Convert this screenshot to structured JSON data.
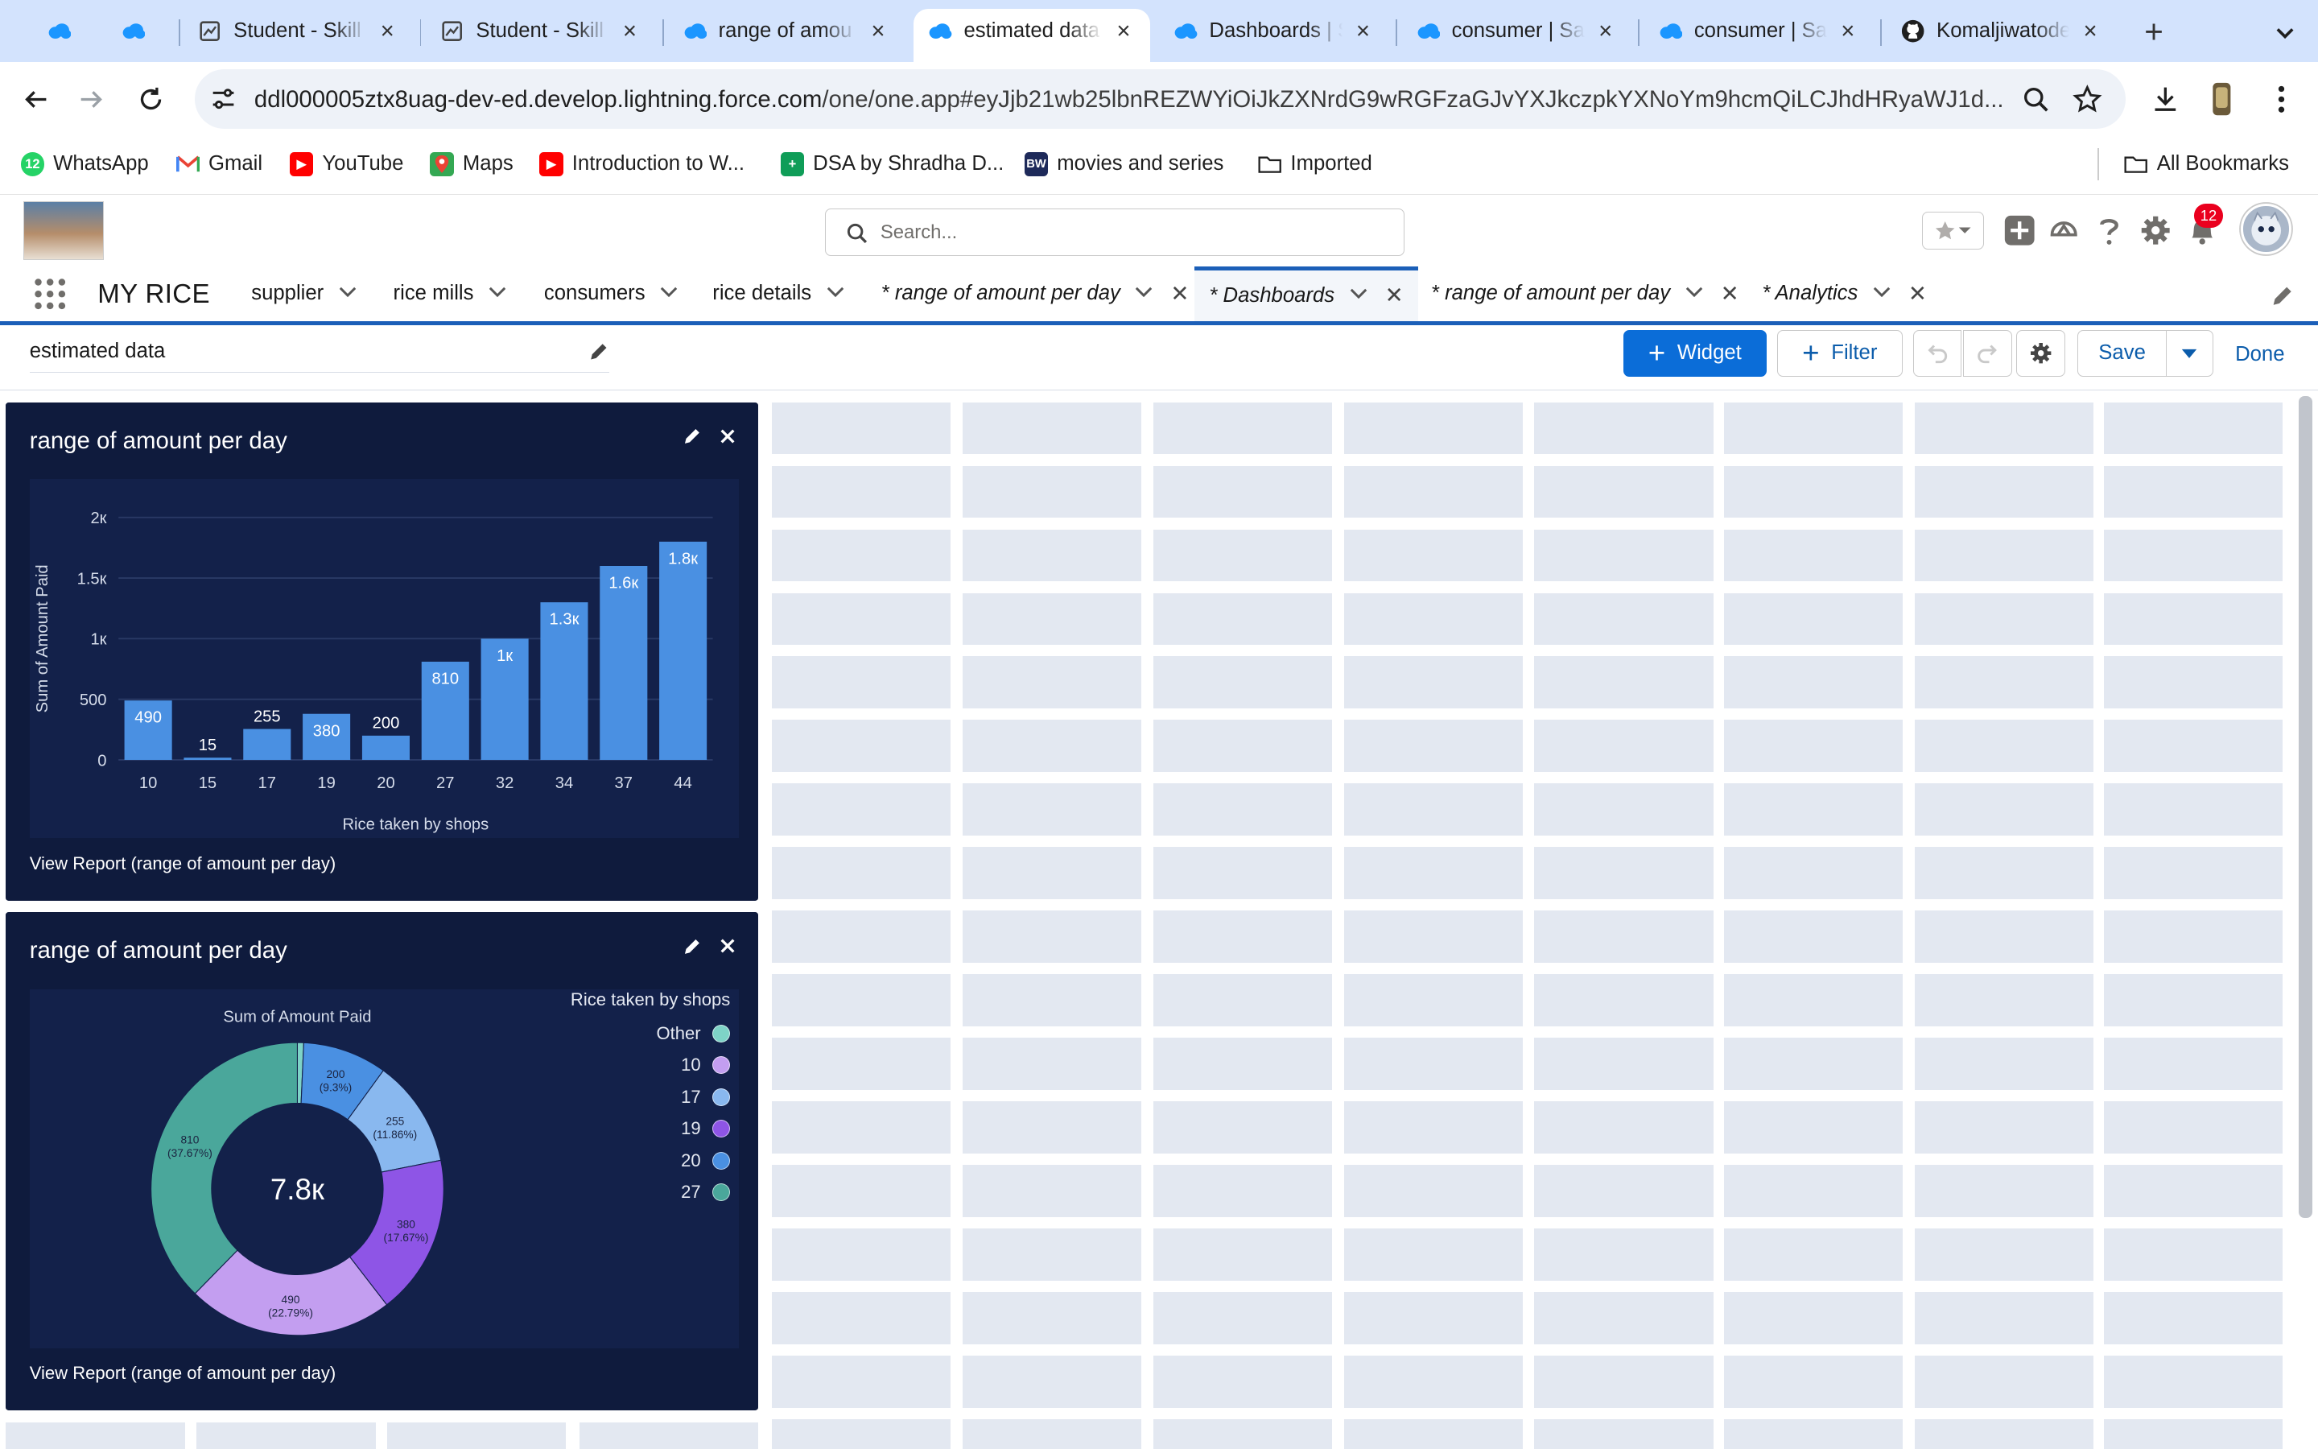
{
  "browser": {
    "tabs": [
      {
        "title": "",
        "icon": "salesforce-cloud-icon",
        "pinned": true
      },
      {
        "title": "",
        "icon": "salesforce-cloud-icon",
        "pinned": true
      },
      {
        "title": "Student - Skill",
        "icon": "document-icon"
      },
      {
        "title": "Student - Skill",
        "icon": "document-icon"
      },
      {
        "title": "range of amou",
        "icon": "salesforce-cloud-icon"
      },
      {
        "title": "estimated data",
        "icon": "salesforce-cloud-icon",
        "active": true
      },
      {
        "title": "Dashboards | Sa",
        "icon": "salesforce-cloud-icon"
      },
      {
        "title": "consumer | Sa",
        "icon": "salesforce-cloud-icon"
      },
      {
        "title": "consumer | Sa",
        "icon": "salesforce-cloud-icon"
      },
      {
        "title": "Komaljiwatode",
        "icon": "github-icon"
      }
    ],
    "url_host": "ddl000005ztx8uag-dev-ed.develop.lightning.force.com",
    "url_path": "/one/one.app#eyJjb21wb25lbnREZWYiOiJkZXNrdG9wRGFzaGJvYXJkczpkYXNoYm9hcmQiLCJhdHRyaWJ1d...",
    "bookmarks": [
      {
        "label": "WhatsApp",
        "icon": "whatsapp-icon",
        "color": "#25d366"
      },
      {
        "label": "Gmail",
        "icon": "gmail-icon",
        "color": "#ea4335"
      },
      {
        "label": "YouTube",
        "icon": "youtube-icon",
        "color": "#ff0000"
      },
      {
        "label": "Maps",
        "icon": "maps-icon",
        "color": "#34a853"
      },
      {
        "label": "Introduction to W...",
        "icon": "youtube-icon",
        "color": "#ff0000"
      },
      {
        "label": "DSA by Shradha D...",
        "icon": "sheets-icon",
        "color": "#0f9d58"
      },
      {
        "label": "movies and series",
        "icon": "bw-icon",
        "color": "#1e2a5a"
      },
      {
        "label": "Imported",
        "icon": "folder-icon",
        "color": "#5f6368"
      }
    ],
    "all_bookmarks": "All Bookmarks"
  },
  "sf": {
    "search_placeholder": "Search...",
    "notification_count": "12",
    "app_name": "MY RICE",
    "nav": [
      {
        "label": "supplier"
      },
      {
        "label": "rice mills"
      },
      {
        "label": "consumers"
      },
      {
        "label": "rice details"
      },
      {
        "label": "* range of amount per day",
        "closable": true
      },
      {
        "label": "* Dashboards",
        "closable": true,
        "current": true
      },
      {
        "label": "* range of amount per day",
        "closable": true
      },
      {
        "label": "* Analytics",
        "closable": true
      }
    ]
  },
  "builder": {
    "dashboard_name": "estimated data",
    "widget_label": "Widget",
    "filter_label": "Filter",
    "save_label": "Save",
    "done_label": "Done"
  },
  "widgets": [
    {
      "title": "range of amount per day",
      "link": "View Report (range of amount per day)"
    },
    {
      "title": "range of amount per day",
      "link": "View Report (range of amount per day)"
    }
  ],
  "chart_data": [
    {
      "type": "bar",
      "categories": [
        "10",
        "15",
        "17",
        "19",
        "20",
        "27",
        "32",
        "34",
        "37",
        "44"
      ],
      "values": [
        490,
        15,
        255,
        380,
        200,
        810,
        1000,
        1300,
        1600,
        1800
      ],
      "data_labels": [
        "490",
        "15",
        "255",
        "380",
        "200",
        "810",
        "1к",
        "1.3к",
        "1.6к",
        "1.8к"
      ],
      "xlabel": "Rice taken by shops",
      "ylabel": "Sum of Amount Paid",
      "yticks": [
        "0",
        "500",
        "1к",
        "1.5к",
        "2к"
      ],
      "ytick_values": [
        0,
        500,
        1000,
        1500,
        2000
      ],
      "ylim": [
        0,
        2000
      ],
      "bar_color": "#4a90e2",
      "grid": true
    },
    {
      "type": "pie",
      "title": "Sum of Amount Paid",
      "center_label": "7.8к",
      "legend_title": "Rice taken by shops",
      "legend_position": "right",
      "slices": [
        {
          "name": "Other",
          "value": 15,
          "label": "",
          "color": "#7ed3c7"
        },
        {
          "name": "20",
          "value": 200,
          "label": "200",
          "pct": "(9.3%)",
          "color": "#4a90e2"
        },
        {
          "name": "17",
          "value": 255,
          "label": "255",
          "pct": "(11.86%)",
          "color": "#89b8ef"
        },
        {
          "name": "19",
          "value": 380,
          "label": "380",
          "pct": "(17.67%)",
          "color": "#8e55e6"
        },
        {
          "name": "10",
          "value": 490,
          "label": "490",
          "pct": "(22.79%)",
          "color": "#c39ef0"
        },
        {
          "name": "27",
          "value": 810,
          "label": "810",
          "pct": "(37.67%)",
          "color": "#4aa79b"
        }
      ],
      "legend": [
        {
          "name": "Other",
          "color": "#7ed3c7"
        },
        {
          "name": "10",
          "color": "#c39ef0"
        },
        {
          "name": "17",
          "color": "#89b8ef"
        },
        {
          "name": "19",
          "color": "#8e55e6"
        },
        {
          "name": "20",
          "color": "#4a90e2"
        },
        {
          "name": "27",
          "color": "#4aa79b"
        }
      ]
    }
  ]
}
